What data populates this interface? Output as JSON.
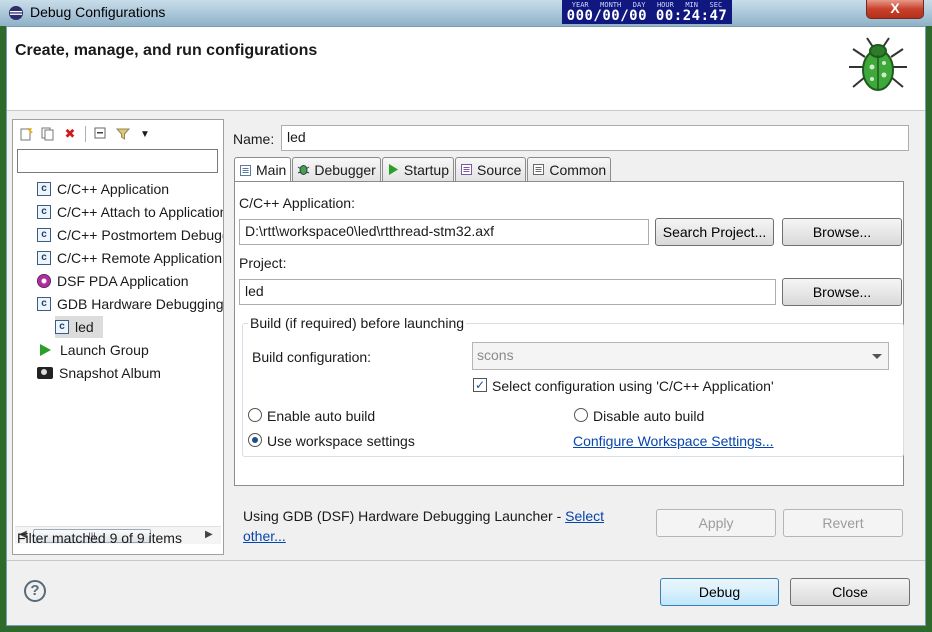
{
  "window": {
    "title": "Debug Configurations",
    "close_glyph": "X"
  },
  "clock": {
    "labels": [
      "YEAR",
      "MONTH",
      "DAY",
      "HOUR",
      "MIN",
      "SEC"
    ],
    "value": "000/00/00 00:24:47"
  },
  "header": {
    "title": "Create, manage, and run configurations",
    "icon": "bug-icon"
  },
  "left_pane": {
    "toolbar_icons": [
      "new-configuration-icon",
      "duplicate-icon",
      "delete-icon",
      "collapse-all-icon",
      "filter-icon",
      "dropdown-arrow-icon"
    ],
    "filter_placeholder": "",
    "filter_value": "",
    "tree": [
      {
        "label": "C/C++ Application",
        "icon": "c-app-icon"
      },
      {
        "label": "C/C++ Attach to Application",
        "icon": "c-app-icon"
      },
      {
        "label": "C/C++ Postmortem Debugger",
        "icon": "c-app-icon"
      },
      {
        "label": "C/C++ Remote Application",
        "icon": "c-app-icon"
      },
      {
        "label": "DSF PDA Application",
        "icon": "dsf-icon"
      },
      {
        "label": "GDB Hardware Debugging",
        "icon": "c-app-icon"
      },
      {
        "label": "led",
        "icon": "c-app-icon",
        "selected": true
      },
      {
        "label": "Launch Group",
        "icon": "launch-group-icon"
      },
      {
        "label": "Snapshot Album",
        "icon": "camera-icon"
      }
    ],
    "scroll_thumb": "III",
    "status": "Filter matched 9 of 9 items"
  },
  "config": {
    "name_label": "Name:",
    "name_value": "led",
    "tabs": [
      {
        "label": "Main",
        "icon": "main-tab-icon",
        "active": true
      },
      {
        "label": "Debugger",
        "icon": "debugger-tab-icon"
      },
      {
        "label": "Startup",
        "icon": "startup-tab-icon"
      },
      {
        "label": "Source",
        "icon": "source-tab-icon"
      },
      {
        "label": "Common",
        "icon": "common-tab-icon"
      }
    ],
    "main": {
      "app_label": "C/C++ Application:",
      "app_value": "D:\\rtt\\workspace0\\led\\rtthread-stm32.axf",
      "search_project_button": "Search Project...",
      "browse_button_1": "Browse...",
      "project_label": "Project:",
      "project_value": "led",
      "browse_button_2": "Browse...",
      "build_group_title": "Build (if required) before launching",
      "build_config_label": "Build configuration:",
      "build_config_value": "scons",
      "select_config_label": "Select configuration using 'C/C++ Application'",
      "select_config_checked": true,
      "enable_auto_build": "Enable auto build",
      "disable_auto_build": "Disable auto build",
      "use_workspace_settings": "Use workspace settings",
      "selected_build_option": "Use workspace settings",
      "configure_workspace_link": "Configure Workspace Settings..."
    },
    "launcher_text": "Using GDB (DSF) Hardware Debugging Launcher - ",
    "launcher_link": "Select other...",
    "apply_button": "Apply",
    "revert_button": "Revert"
  },
  "footer": {
    "help_glyph": "?",
    "debug_button": "Debug",
    "close_button": "Close"
  }
}
